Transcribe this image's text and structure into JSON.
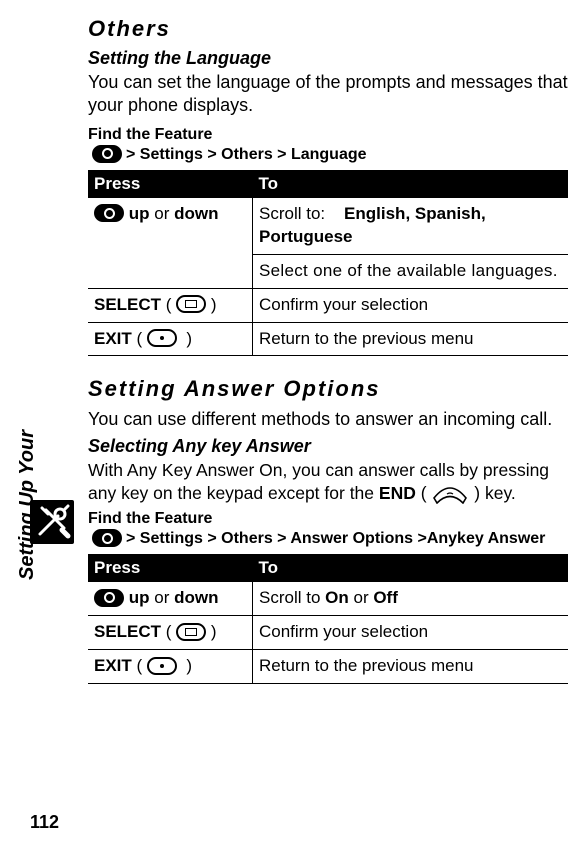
{
  "section_label": "Setting Up Your",
  "page_number": "112",
  "sections": {
    "others_heading": "Others",
    "lang": {
      "subheading": "Setting the Language",
      "desc": "You can set the language of the prompts and messages that your phone displays.",
      "find": "Find the Feature",
      "path": " > Settings > Others > Language"
    },
    "table_h_press": "Press",
    "table_h_to": "To",
    "lang_table": {
      "r1_press_part1": " up ",
      "r1_press_or": "or",
      "r1_press_part2": " down",
      "r1a_to_prefix": "Scroll to:",
      "r1a_to_bold": "English, Spanish, Portuguese",
      "r1b_to": "Select one of the available languages.",
      "r2_press_label": "SELECT",
      "r2_to": "Confirm your selection",
      "r3_press_label": "EXIT",
      "r3_to": "Return to the previous menu"
    },
    "answer": {
      "heading": "Setting Answer Options",
      "desc": "You can use different methods to answer an incoming call.",
      "sub": "Selecting Any key Answer",
      "desc2_pre": "With Any Key Answer On, you can answer calls by pressing any key on the keypad except for the ",
      "end_label": "END",
      "desc2_post": " key.",
      "find": "Find the Feature",
      "path": " > Settings > Others > Answer Options >Anykey Answer"
    },
    "ans_table": {
      "r1_press_part1": " up ",
      "r1_press_or": "or",
      "r1_press_part2": " down",
      "r1_to_prefix": "Scroll to ",
      "r1_to_on": "On",
      "r1_to_or": " or ",
      "r1_to_off": "Off",
      "r2_press_label": "SELECT",
      "r2_to": "Confirm your selection",
      "r3_press_label": "EXIT",
      "r3_to": "Return to the previous menu"
    }
  }
}
